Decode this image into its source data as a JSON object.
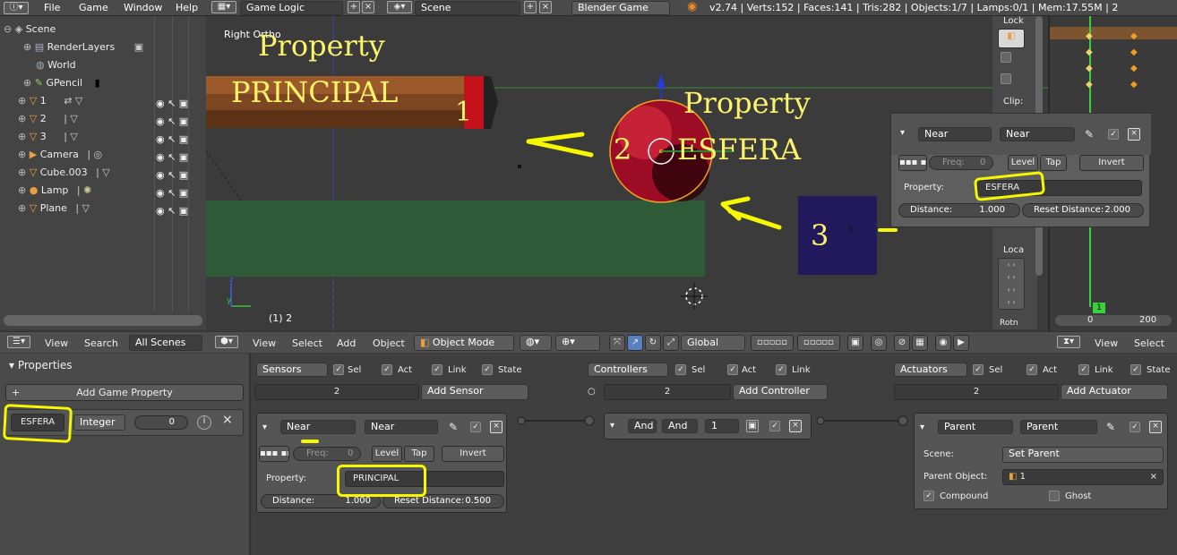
{
  "topbar": {
    "menu": [
      "File",
      "Game",
      "Window",
      "Help"
    ],
    "screen_layout": "Game Logic",
    "scene": "Scene",
    "engine": "Blender Game",
    "stats": "v2.74 | Verts:152 | Faces:141 | Tris:282 | Objects:1/7 | Lamps:0/1 | Mem:17.55M | 2"
  },
  "outliner": {
    "items": [
      "Scene",
      "RenderLayers",
      "World",
      "GPencil",
      "1",
      "2",
      "3",
      "Camera",
      "Cube.003",
      "Lamp",
      "Plane"
    ],
    "footer": {
      "view": "View",
      "search": "Search",
      "filter": "All Scenes"
    }
  },
  "viewport": {
    "label": "Right Ortho",
    "frame": "(1) 2",
    "obj3_name": "3",
    "menu": [
      "View",
      "Select",
      "Add",
      "Object"
    ],
    "mode": "Object Mode",
    "orientation": "Global"
  },
  "annotations": {
    "property1": "Property",
    "principal": "PRINCIPAL",
    "num1": "1",
    "num2": "2",
    "property2": "Property",
    "esfera": "ESFERA",
    "num3": "3"
  },
  "float_panel": {
    "sensor_type": "Near",
    "sensor_name": "Near",
    "freq_label": "Freq:",
    "freq": "0",
    "level": "Level",
    "tap": "Tap",
    "invert": "Invert",
    "property_label": "Property:",
    "property": "ESFERA",
    "distance_label": "Distance:",
    "distance": "1.000",
    "reset_label": "Reset Distance:",
    "reset": "2.000"
  },
  "side_panel": {
    "lock": "Lock",
    "clip": "Clip:",
    "loca": "Loca",
    "rotn": "Rotn"
  },
  "timeline": {
    "frame_marker": "1",
    "ticks": [
      "0",
      "200"
    ],
    "view": "View",
    "select": "Select"
  },
  "properties": {
    "title": "Properties",
    "add_button": "Add Game Property",
    "prop_name": "ESFERA",
    "prop_type": "Integer",
    "prop_value": "0"
  },
  "sensors": {
    "header": "Sensors",
    "sel": "Sel",
    "act": "Act",
    "link": "Link",
    "state": "State",
    "count": "2",
    "add": "Add Sensor",
    "type": "Near",
    "name": "Near",
    "freq_label": "Freq:",
    "freq": "0",
    "level": "Level",
    "tap": "Tap",
    "invert": "Invert",
    "property_label": "Property:",
    "property": "PRINCIPAL",
    "distance_label": "Distance:",
    "distance": "1.000",
    "reset_label": "Reset Distance:",
    "reset": "0.500"
  },
  "controllers": {
    "header": "Controllers",
    "sel": "Sel",
    "act": "Act",
    "link": "Link",
    "count": "2",
    "add": "Add Controller",
    "type": "And",
    "name": "And",
    "state": "1"
  },
  "actuators": {
    "header": "Actuators",
    "sel": "Sel",
    "act": "Act",
    "link": "Link",
    "state": "State",
    "count": "2",
    "add": "Add Actuator",
    "type": "Parent",
    "name": "Parent",
    "scene_label": "Scene:",
    "scene_value": "Set Parent",
    "parent_label": "Parent Object:",
    "parent_value": "1",
    "compound": "Compound",
    "ghost": "Ghost"
  }
}
